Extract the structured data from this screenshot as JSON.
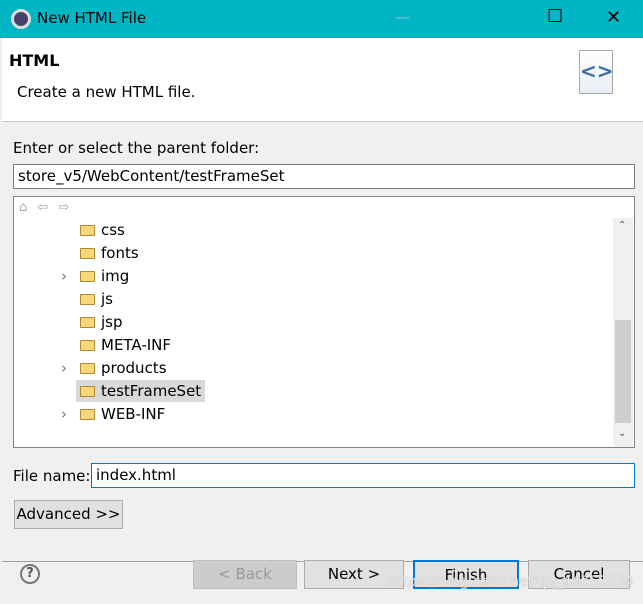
{
  "window": {
    "title": "New HTML File",
    "minimize": "—",
    "maximize": "☐",
    "close": "✕"
  },
  "header": {
    "title": "HTML",
    "description": "Create a new HTML file.",
    "icon": "html-file-icon"
  },
  "parent_folder": {
    "label": "Enter or select the parent folder:",
    "value": "store_v5/WebContent/testFrameSet"
  },
  "tree": {
    "toolbar": [
      "home-icon",
      "back-arrow-icon",
      "forward-arrow-icon"
    ],
    "items": [
      {
        "label": "css",
        "expandable": false
      },
      {
        "label": "fonts",
        "expandable": false
      },
      {
        "label": "img",
        "expandable": true
      },
      {
        "label": "js",
        "expandable": false
      },
      {
        "label": "jsp",
        "expandable": false
      },
      {
        "label": "META-INF",
        "expandable": false
      },
      {
        "label": "products",
        "expandable": true
      },
      {
        "label": "testFrameSet",
        "expandable": false,
        "selected": true
      },
      {
        "label": "WEB-INF",
        "expandable": true
      }
    ]
  },
  "file_name": {
    "label": "File name:",
    "value": "index.html"
  },
  "advanced_label": "Advanced >>",
  "buttons": {
    "back": "< Back",
    "next": "Next >",
    "finish": "Finish",
    "cancel": "Cancel"
  },
  "watermark": "https://blog.csdn.net/qq_44757034",
  "colors": {
    "titlebar": "#00b5c4",
    "focus": "#0078d7"
  }
}
